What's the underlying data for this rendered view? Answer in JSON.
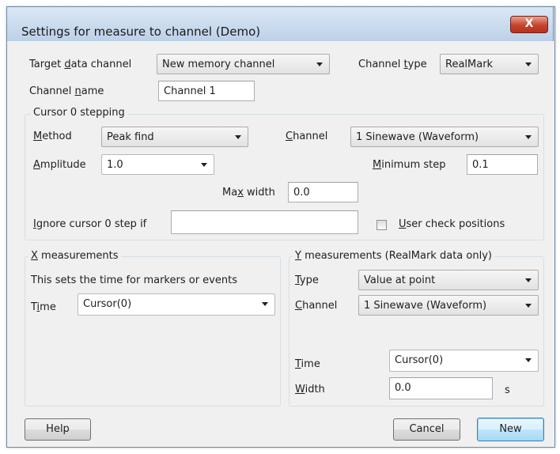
{
  "window": {
    "title": "Settings for measure to channel (Demo)",
    "close_glyph": "X"
  },
  "target": {
    "label_pre": "Target ",
    "label_key": "d",
    "label_post": "ata channel",
    "value": "New memory channel"
  },
  "channel_type": {
    "label_pre": "Channel ",
    "label_key": "t",
    "label_post": "ype",
    "value": "RealMark"
  },
  "channel_name": {
    "label_pre": "Channel ",
    "label_key": "n",
    "label_post": "ame",
    "value": "Channel 1"
  },
  "cursor_stepping": {
    "group_label": "Cursor 0 stepping",
    "method": {
      "label_key": "M",
      "label_post": "ethod",
      "value": "Peak find"
    },
    "channel": {
      "label_key": "C",
      "label_post": "hannel",
      "value": "1 Sinewave (Waveform)"
    },
    "amplitude": {
      "label_key": "A",
      "label_post": "mplitude",
      "value": "1.0"
    },
    "min_step": {
      "label_key": "M",
      "label_post": "inimum step",
      "value": "0.1"
    },
    "max_width": {
      "label_pre": "Ma",
      "label_key": "x",
      "label_post": " width",
      "value": "0.0"
    },
    "ignore": {
      "label_key": "I",
      "label_post": "gnore cursor 0 step if",
      "value": ""
    },
    "user_check": {
      "label_key": "U",
      "label_post": "ser check positions",
      "checked": false
    }
  },
  "x_measurements": {
    "group_label_key": "X",
    "group_label_post": " measurements",
    "description": "This sets the time for markers or events",
    "time": {
      "label_pre": "T",
      "label_key": "i",
      "label_post": "me",
      "value": "Cursor(0)"
    }
  },
  "y_measurements": {
    "group_label_key": "Y",
    "group_label_post": " measurements (RealMark data only)",
    "type": {
      "label_key": "T",
      "label_post": "ype",
      "value": "Value at point"
    },
    "channel": {
      "label_key": "C",
      "label_post": "hannel",
      "value": "1 Sinewave (Waveform)"
    },
    "time": {
      "label_key": "T",
      "label_post": "ime",
      "value": "Cursor(0)"
    },
    "width": {
      "label_key": "W",
      "label_post": "idth",
      "value": "0.0",
      "unit": "s"
    }
  },
  "buttons": {
    "help": "Help",
    "cancel": "Cancel",
    "new": "New"
  }
}
